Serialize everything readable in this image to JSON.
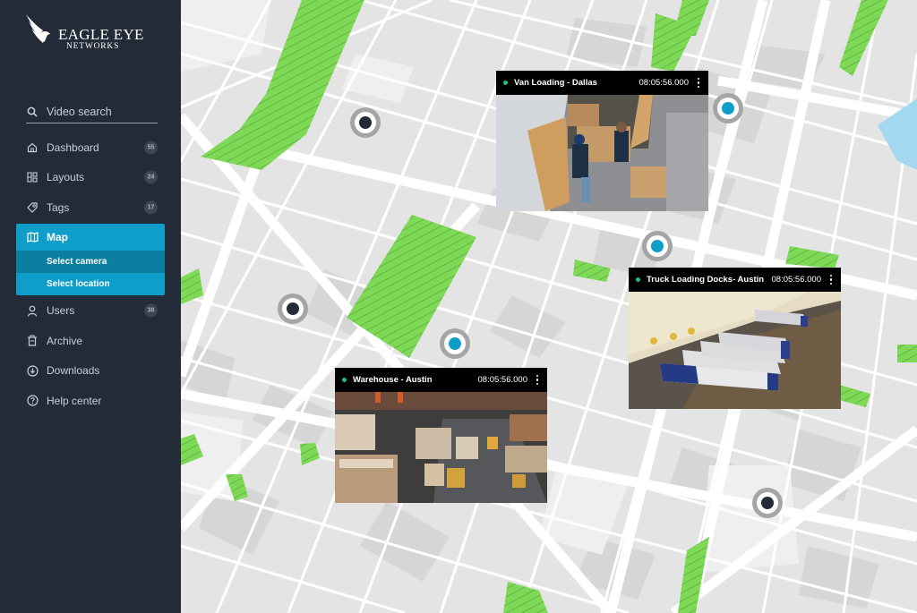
{
  "brand": {
    "line1": "EAGLE EYE",
    "line2": "NETWORKS"
  },
  "search": {
    "icon": "search-icon",
    "label": "Video search"
  },
  "nav": {
    "items": [
      {
        "id": "dashboard",
        "label": "Dashboard",
        "icon": "home-icon",
        "badge": "55"
      },
      {
        "id": "layouts",
        "label": "Layouts",
        "icon": "layouts-icon",
        "badge": "24"
      },
      {
        "id": "tags",
        "label": "Tags",
        "icon": "tag-icon",
        "badge": "17"
      }
    ],
    "map": {
      "label": "Map",
      "icon": "map-icon",
      "sub_items": [
        {
          "label": "Select camera",
          "active": true
        },
        {
          "label": "Select location",
          "active": false
        }
      ]
    },
    "items_after": [
      {
        "id": "users",
        "label": "Users",
        "icon": "user-icon",
        "badge": "38"
      },
      {
        "id": "archive",
        "label": "Archive",
        "icon": "trash-icon",
        "badge": null
      },
      {
        "id": "downloads",
        "label": "Downloads",
        "icon": "download-icon",
        "badge": null
      },
      {
        "id": "help",
        "label": "Help center",
        "icon": "help-icon",
        "badge": null
      }
    ]
  },
  "colors": {
    "sidebar_bg": "#232b38",
    "accent": "#0e9ec9",
    "accent_dark": "#0a7f9f",
    "park": "#7ed957",
    "water": "#a3d8ee",
    "status_online": "#1fbf7a",
    "marker_active": "#0e9ec9",
    "marker_inactive": "#232b38"
  },
  "map": {
    "markers": [
      {
        "id": "m1",
        "state": "inactive"
      },
      {
        "id": "m2",
        "state": "active"
      },
      {
        "id": "m3",
        "state": "active"
      },
      {
        "id": "m4",
        "state": "inactive"
      },
      {
        "id": "m5",
        "state": "active"
      },
      {
        "id": "m6",
        "state": "inactive"
      }
    ],
    "cameras": [
      {
        "id": "van",
        "name": "Van Loading - Dallas",
        "time": "08:05:56.000",
        "status": "online"
      },
      {
        "id": "truck",
        "name": "Truck Loading Docks- Austin",
        "time": "08:05:56.000",
        "status": "online"
      },
      {
        "id": "warehouse",
        "name": "Warehouse - Austin",
        "time": "08:05:56.000",
        "status": "online"
      }
    ]
  }
}
